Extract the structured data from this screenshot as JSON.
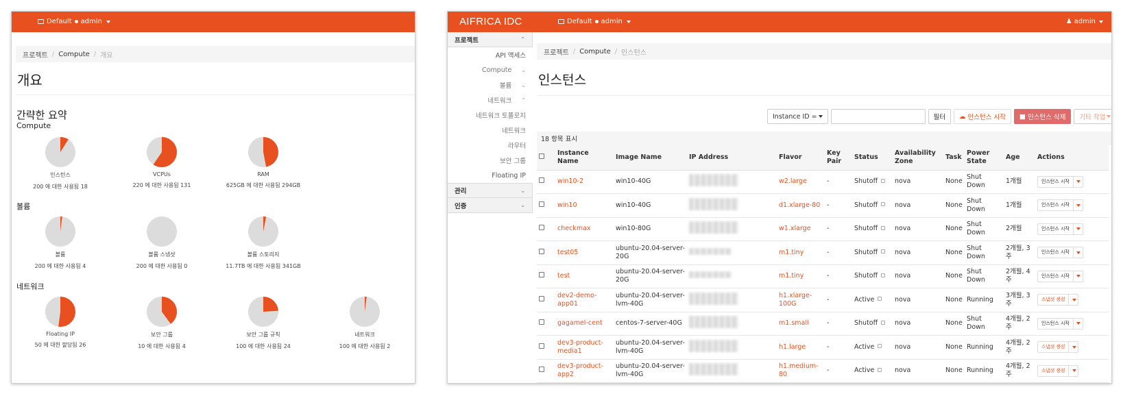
{
  "colors": {
    "brand": "#e8511f",
    "pie_used": "#e8511f",
    "pie_free": "#dcdcdc"
  },
  "overview": {
    "topbar": {
      "project_label": "Default",
      "user_label": "admin"
    },
    "breadcrumb": [
      "프로젝트",
      "Compute",
      "개요"
    ],
    "page_title": "개요",
    "summary_title": "간략한 요약",
    "sections": [
      {
        "title": "Compute",
        "pies": [
          {
            "label": "인스턴스",
            "usage": "200 에 대한 사용됨 18",
            "used_fraction": 0.09
          },
          {
            "label": "VCPUs",
            "usage": "220 에 대한 사용됨 131",
            "used_fraction": 0.595
          },
          {
            "label": "RAM",
            "usage": "625GB 에 대한 사용됨 294GB",
            "used_fraction": 0.47
          }
        ]
      },
      {
        "title": "볼륨",
        "pies": [
          {
            "label": "볼륨",
            "usage": "200 에 대한 사용됨 4",
            "used_fraction": 0.02
          },
          {
            "label": "볼륨 스냅샷",
            "usage": "200 에 대한 사용됨 0",
            "used_fraction": 0
          },
          {
            "label": "볼륨 스토리지",
            "usage": "11.7TB 에 대한 사용됨 341GB",
            "used_fraction": 0.03
          }
        ]
      },
      {
        "title": "네트워크",
        "pies": [
          {
            "label": "Floating IP",
            "usage": "50 에 대한 할당됨 26",
            "used_fraction": 0.52
          },
          {
            "label": "보안 그룹",
            "usage": "10 에 대한 사용됨 4",
            "used_fraction": 0.4
          },
          {
            "label": "보안 그룹 규칙",
            "usage": "100 에 대한 사용됨 24",
            "used_fraction": 0.24
          },
          {
            "label": "네트워크",
            "usage": "100 에 대한 사용됨 2",
            "used_fraction": 0.02
          }
        ]
      }
    ]
  },
  "instances": {
    "topbar": {
      "brand": "AIFRICA IDC",
      "project_label": "Default",
      "user_label": "admin"
    },
    "sidebar": {
      "project_header": "프로젝트",
      "items": [
        {
          "label": "API 액세스",
          "arrow": ""
        },
        {
          "label": "Compute",
          "arrow": "⌄"
        },
        {
          "label": "볼륨",
          "arrow": "⌄"
        },
        {
          "label": "네트워크",
          "arrow": "⌃"
        },
        {
          "label": "네트워크 토폴로지",
          "arrow": ""
        },
        {
          "label": "네트워크",
          "arrow": ""
        },
        {
          "label": "라우터",
          "arrow": ""
        },
        {
          "label": "보안 그룹",
          "arrow": ""
        },
        {
          "label": "Floating IP",
          "arrow": ""
        }
      ],
      "admin_header": "관리",
      "auth_header": "인증"
    },
    "breadcrumb": [
      "프로젝트",
      "Compute",
      "인스턴스"
    ],
    "page_title": "인스턴스",
    "toolbar": {
      "filter_select": "Instance ID =",
      "filter_button": "필터",
      "launch_button": "인스턴스 시작",
      "delete_button": "인스턴스 삭제",
      "more_actions": "기타 작업"
    },
    "count_text": "18 항목 표시",
    "columns": [
      "Instance Name",
      "Image Name",
      "IP Address",
      "Flavor",
      "Key Pair",
      "Status",
      "Availability Zone",
      "Task",
      "Power State",
      "Age",
      "Actions"
    ],
    "rows": [
      {
        "name": "win10-2",
        "image": "win10-40G",
        "flavor": "w2.large",
        "key_pair": "-",
        "status": "Shutoff",
        "zone": "nova",
        "task": "None",
        "power": "Shut Down",
        "age": "1개월",
        "action": "인스턴스 시작"
      },
      {
        "name": "win10",
        "image": "win10-40G",
        "flavor": "d1.xlarge-80",
        "key_pair": "-",
        "status": "Shutoff",
        "zone": "nova",
        "task": "None",
        "power": "Shut Down",
        "age": "1개월",
        "action": "인스턴스 시작"
      },
      {
        "name": "checkmax",
        "image": "win10-80G",
        "flavor": "w1.xlarge",
        "key_pair": "-",
        "status": "Shutoff",
        "zone": "nova",
        "task": "None",
        "power": "Shut Down",
        "age": "2개월",
        "action": "인스턴스 시작"
      },
      {
        "name": "test05",
        "image": "ubuntu-20.04-server-20G",
        "flavor": "m1.tiny",
        "key_pair": "-",
        "status": "Shutoff",
        "zone": "nova",
        "task": "None",
        "power": "Shut Down",
        "age": "2개월, 3 주",
        "action": "인스턴스 시작"
      },
      {
        "name": "test",
        "image": "ubuntu-20.04-server-20G",
        "flavor": "m1.tiny",
        "key_pair": "-",
        "status": "Shutoff",
        "zone": "nova",
        "task": "None",
        "power": "Shut Down",
        "age": "2개월, 4 주",
        "action": "인스턴스 시작"
      },
      {
        "name": "dev2-demo-app01",
        "image": "ubuntu-20.04-server-lvm-40G",
        "flavor": "h1.xlarge-100G",
        "key_pair": "-",
        "status": "Active",
        "zone": "nova",
        "task": "None",
        "power": "Running",
        "age": "3개월, 3 주",
        "action": "스냅샷 생성"
      },
      {
        "name": "gagamel-cent",
        "image": "centos-7-server-40G",
        "flavor": "m1.small",
        "key_pair": "-",
        "status": "Shutoff",
        "zone": "nova",
        "task": "None",
        "power": "Shut Down",
        "age": "4개월, 2 주",
        "action": "인스턴스 시작"
      },
      {
        "name": "dev3-product-media1",
        "image": "ubuntu-20.04-server-lvm-40G",
        "flavor": "h1.large",
        "key_pair": "-",
        "status": "Active",
        "zone": "nova",
        "task": "None",
        "power": "Running",
        "age": "4개월, 2 주",
        "action": "스냅샷 생성"
      },
      {
        "name": "dev3-product-app2",
        "image": "ubuntu-20.04-server-lvm-40G",
        "flavor": "h1.medium-80",
        "key_pair": "-",
        "status": "Active",
        "zone": "nova",
        "task": "None",
        "power": "Running",
        "age": "4개월, 2 주",
        "action": "스냅샷 생성"
      }
    ]
  }
}
